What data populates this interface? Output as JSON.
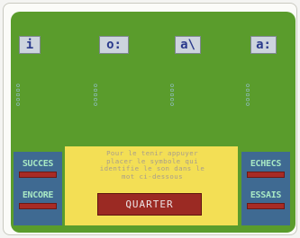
{
  "tiles": [
    "i",
    "o:",
    "a\\",
    "a:"
  ],
  "lane_labels": [
    "ooooo",
    "ooooo",
    "ooooo",
    "ooooo"
  ],
  "left_panel": {
    "top_label": "SUCCES",
    "bottom_label": "ENCORE"
  },
  "right_panel": {
    "top_label": "ECHECS",
    "bottom_label": "ESSAIS"
  },
  "message": "Pour le tenir appuyer\nplacer le symbole qui\nidentifie le son dans le\nmot ci-dessous",
  "quit_label": "QUARTER",
  "colors": {
    "field": "#5a9c2c",
    "panel": "#3f6a92",
    "message_bg": "#f3df55",
    "button": "#9b2a23",
    "tile": "#cdd4de"
  }
}
